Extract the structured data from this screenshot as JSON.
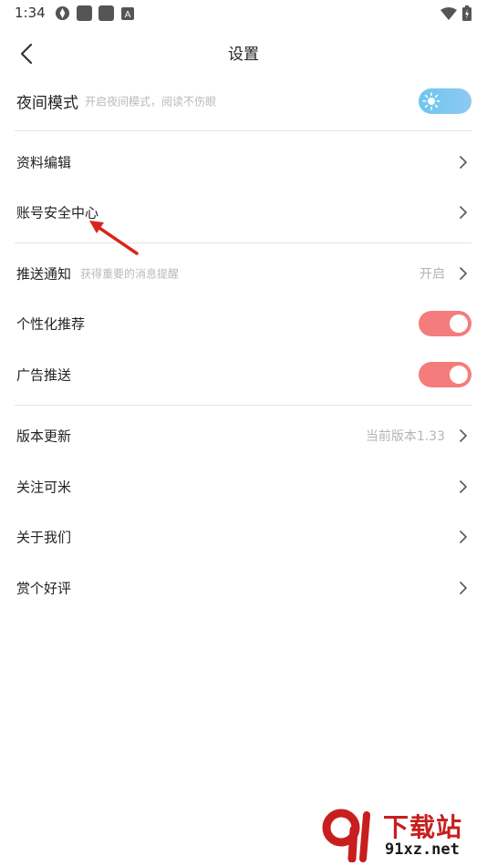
{
  "status_bar": {
    "time": "1:34"
  },
  "header": {
    "title": "设置"
  },
  "night_mode": {
    "label": "夜间模式",
    "hint": "开启夜间模式，阅读不伤眼",
    "enabled": false
  },
  "group1": [
    {
      "label": "资料编辑"
    },
    {
      "label": "账号安全中心"
    }
  ],
  "push": {
    "label": "推送通知",
    "hint": "获得重要的消息提醒",
    "value": "开启"
  },
  "personalized": {
    "label": "个性化推荐",
    "enabled": true
  },
  "ads": {
    "label": "广告推送",
    "enabled": true
  },
  "group3": [
    {
      "label": "版本更新",
      "value": "当前版本1.33"
    },
    {
      "label": "关注可米"
    },
    {
      "label": "关于我们"
    },
    {
      "label": "赏个好评"
    }
  ],
  "watermark": {
    "brand": "下载站",
    "domain": "91xz.net"
  },
  "colors": {
    "toggle_on": "#f47c7c",
    "night_toggle": "#7cc8f1",
    "annotation_arrow": "#d9251c"
  }
}
